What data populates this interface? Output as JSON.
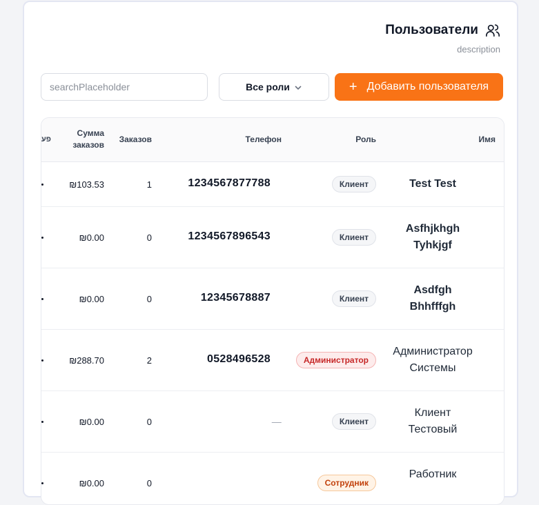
{
  "header": {
    "title": "Пользователи",
    "description": "description"
  },
  "toolbar": {
    "search_placeholder": "searchPlaceholder",
    "role_filter": "Все роли",
    "add_button": "Добавить пользователя",
    "add_icon": "+"
  },
  "table": {
    "columns": {
      "partial": "פע",
      "sum": "Сумма заказов",
      "orders": "Заказов",
      "phone": "Телефон",
      "role": "Роль",
      "name": "Имя"
    },
    "rows": [
      {
        "sum": "₪103.53",
        "orders": "1",
        "phone": "1234567877788",
        "role": "Клиент",
        "name_line1": "Test Test",
        "name_line2": ""
      },
      {
        "sum": "₪0.00",
        "orders": "0",
        "phone": "1234567896543",
        "role": "Клиент",
        "name_line1": "Asfhjkhgh",
        "name_line2": "Tyhkjgf"
      },
      {
        "sum": "₪0.00",
        "orders": "0",
        "phone": "12345678887",
        "role": "Клиент",
        "name_line1": "Asdfgh",
        "name_line2": "Bhhfffgh"
      },
      {
        "sum": "₪288.70",
        "orders": "2",
        "phone": "0528496528",
        "role": "Администратор",
        "name_line1": "Администратор",
        "name_line2": "Системы"
      },
      {
        "sum": "₪0.00",
        "orders": "0",
        "phone": "—",
        "role": "Клиент",
        "name_line1": "Клиент",
        "name_line2": "Тестовый"
      },
      {
        "sum": "₪0.00",
        "orders": "0",
        "phone": "",
        "role": "Сотрудник",
        "name_line1": "Работник",
        "name_line2": ""
      }
    ]
  },
  "colors": {
    "accent": "#f97316",
    "admin_badge": "#c62828",
    "staff_badge": "#c2410c"
  },
  "icons": {
    "title_icon": "users-icon",
    "filter_icon": "chevron-down-icon"
  }
}
